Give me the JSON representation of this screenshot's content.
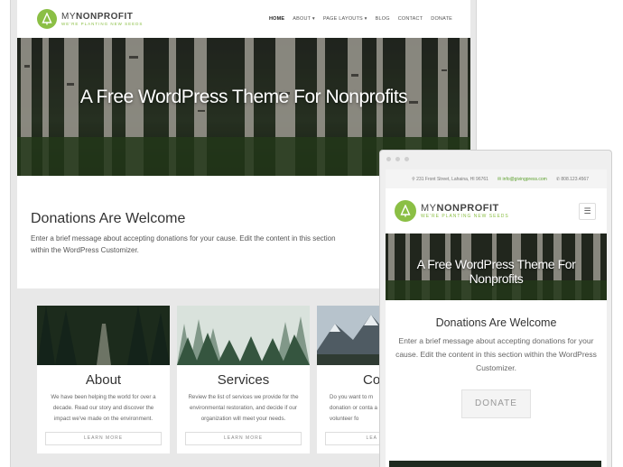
{
  "brand": {
    "name_light": "MY",
    "name_bold": "NONPROFIT",
    "tagline": "WE'RE PLANTING NEW SEEDS",
    "color": "#8bbf45"
  },
  "desktop": {
    "nav": [
      "HOME",
      "ABOUT",
      "PAGE LAYOUTS",
      "BLOG",
      "CONTACT",
      "DONATE"
    ],
    "active_nav": "HOME",
    "hero_title": "A Free WordPress Theme For Nonprofits",
    "donate_title": "Donations Are Welcome",
    "donate_text": "Enter a brief message about accepting donations for your cause. Edit the content in this section within the WordPress Customizer.",
    "cards": [
      {
        "title": "About",
        "text": "We have been helping the world for over a decade. Read our story and discover the impact we've made on the environment.",
        "button": "LEARN MORE"
      },
      {
        "title": "Services",
        "text": "Review the list of services we provide for the environmental restoration, and decide if our organization will meet your needs.",
        "button": "LEARN MORE"
      },
      {
        "title": "Co",
        "text": "Do you want to m donation or conta a volunteer fo",
        "button": "LEA"
      }
    ]
  },
  "mobile": {
    "address": "231 Front Street, Lahaina, HI 96761",
    "email": "info@givingpress.com",
    "phone": "808.123.4567",
    "menu_icon": "hamburger-icon",
    "hero_title": "A Free WordPress Theme For Nonprofits",
    "donate_title": "Donations Are Welcome",
    "donate_text": "Enter a brief message about accepting donations for your cause. Edit the content in this section within the WordPress Customizer.",
    "donate_button": "DONATE"
  }
}
